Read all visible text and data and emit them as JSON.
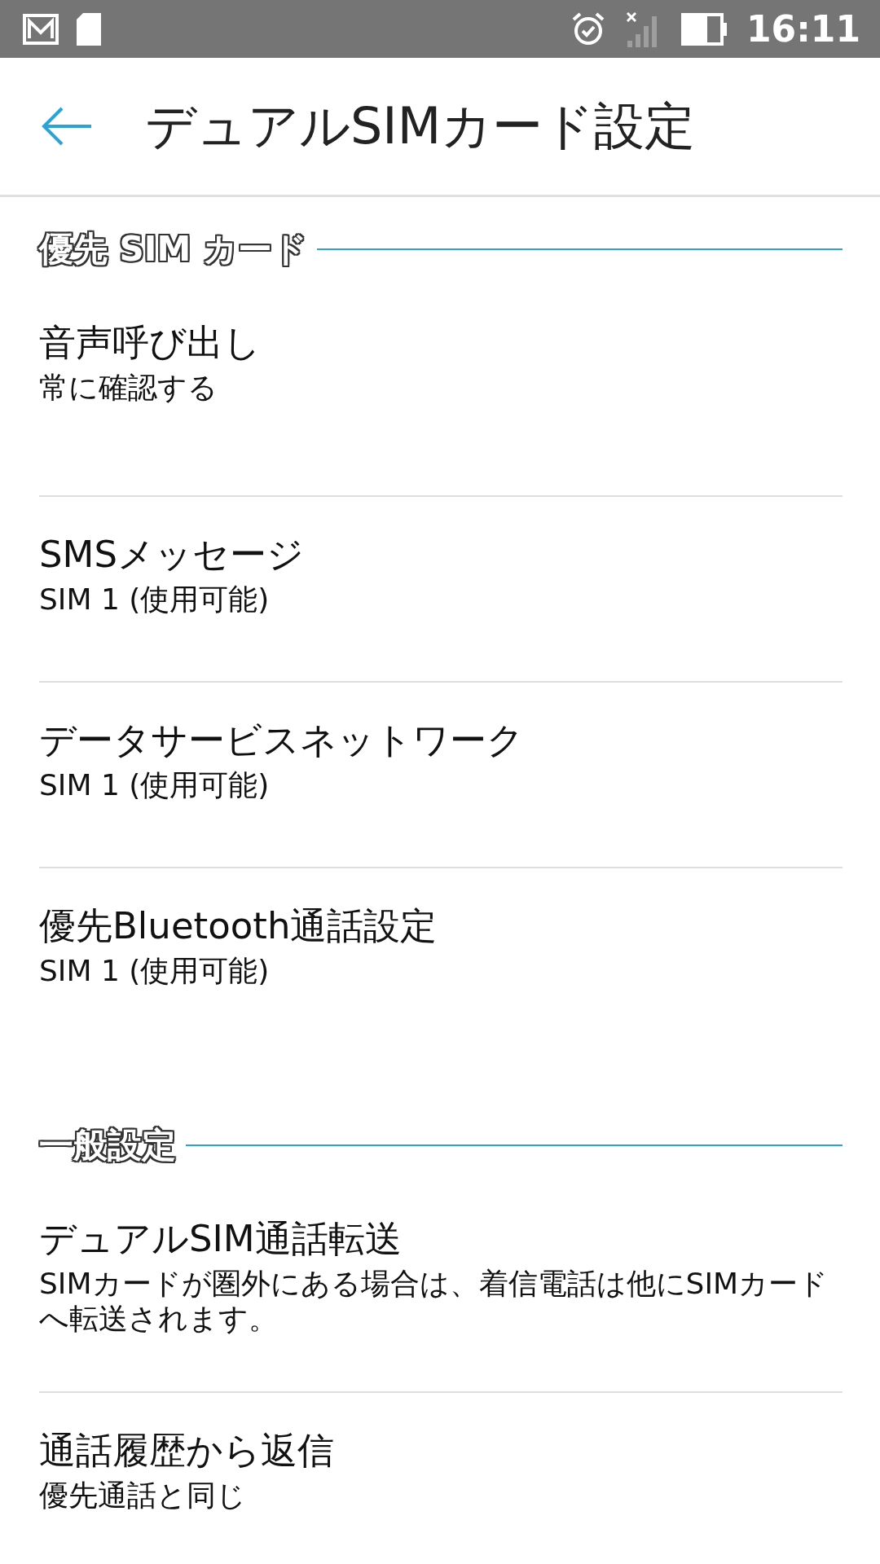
{
  "status_bar": {
    "time": "16:11"
  },
  "header": {
    "title": "デュアルSIMカード設定"
  },
  "sections": [
    {
      "title": "優先 SIM カード",
      "items": [
        {
          "title": "音声呼び出し",
          "subtitle": "常に確認する"
        },
        {
          "title": "SMSメッセージ",
          "subtitle": "SIM 1 (使用可能)"
        },
        {
          "title": "データサービスネットワーク",
          "subtitle": "SIM 1 (使用可能)"
        },
        {
          "title": "優先Bluetooth通話設定",
          "subtitle": "SIM 1 (使用可能)"
        }
      ]
    },
    {
      "title": "一般設定",
      "items": [
        {
          "title": "デュアルSIM通話転送",
          "subtitle": "SIMカードが圏外にある場合は、着信電話は他にSIMカードへ転送されます。"
        },
        {
          "title": "通話履歴から返信",
          "subtitle": "優先通話と同じ"
        }
      ]
    }
  ]
}
